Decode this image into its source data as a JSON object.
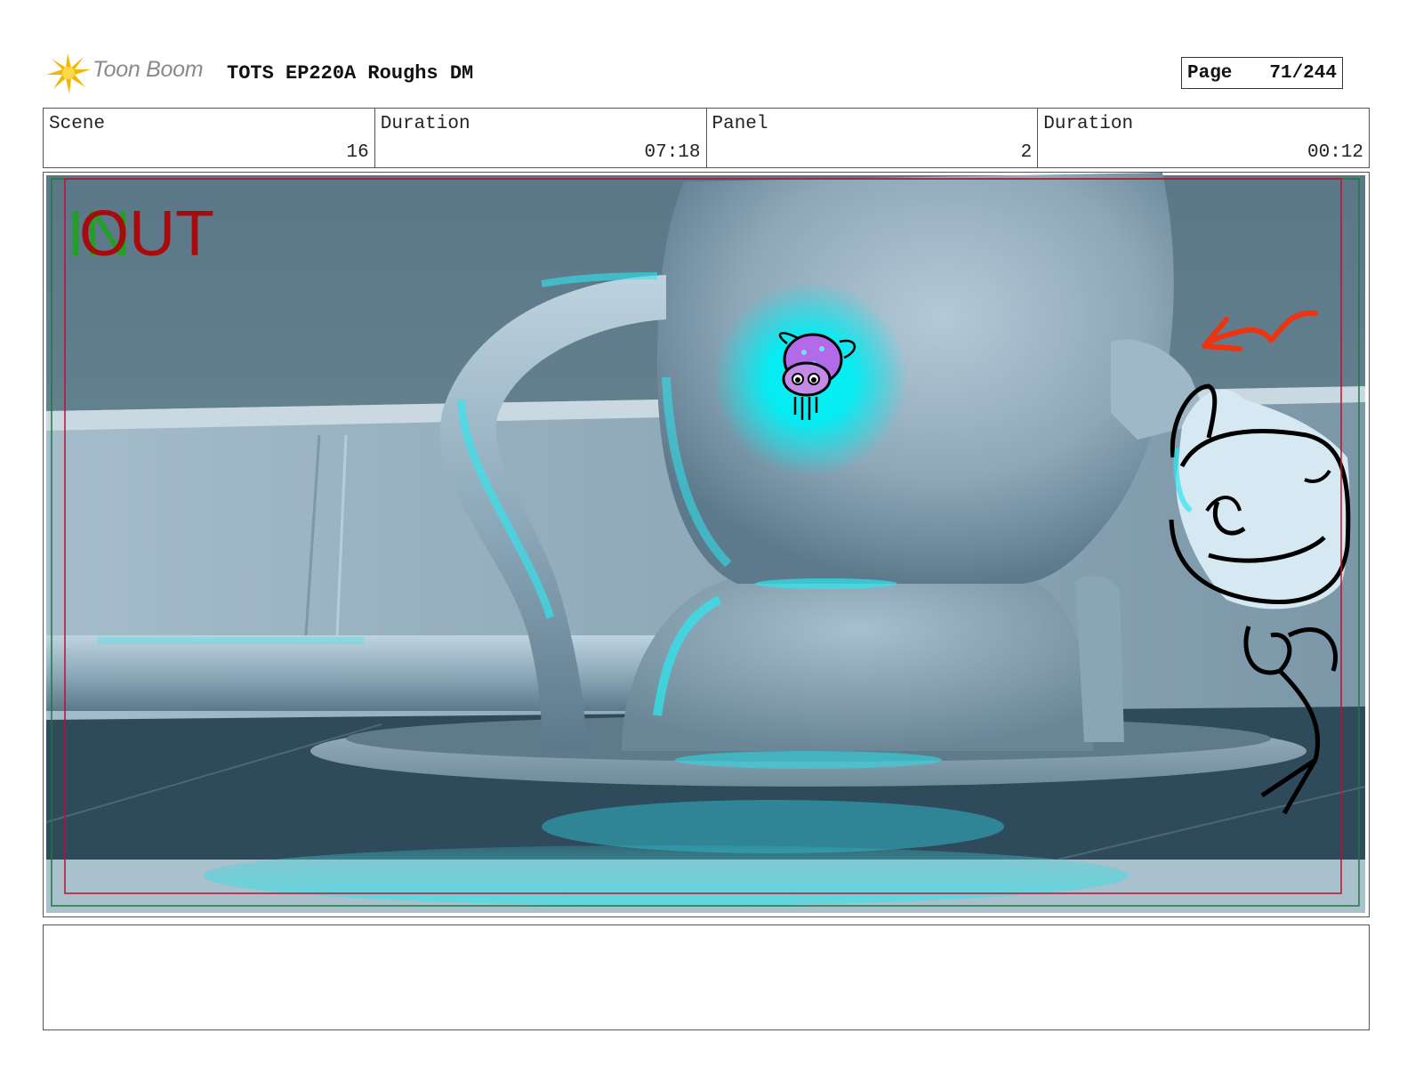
{
  "header": {
    "logo_text": "Toon Boom",
    "title": "TOTS EP220A Roughs DM",
    "page_label": "Page",
    "page_value": "71/244"
  },
  "info": {
    "scene_label": "Scene",
    "scene_value": "16",
    "scene_duration_label": "Duration",
    "scene_duration_value": "07:18",
    "panel_label": "Panel",
    "panel_value": "2",
    "panel_duration_label": "Duration",
    "panel_duration_value": "00:12"
  },
  "panel": {
    "in_marker": "IN",
    "out_marker": "OUT"
  },
  "notes": {
    "text": ""
  },
  "colors": {
    "in_marker": "#1fa21f",
    "out_marker": "#b00000",
    "arrow": "#ee3311",
    "glow": "#00f0f5"
  }
}
